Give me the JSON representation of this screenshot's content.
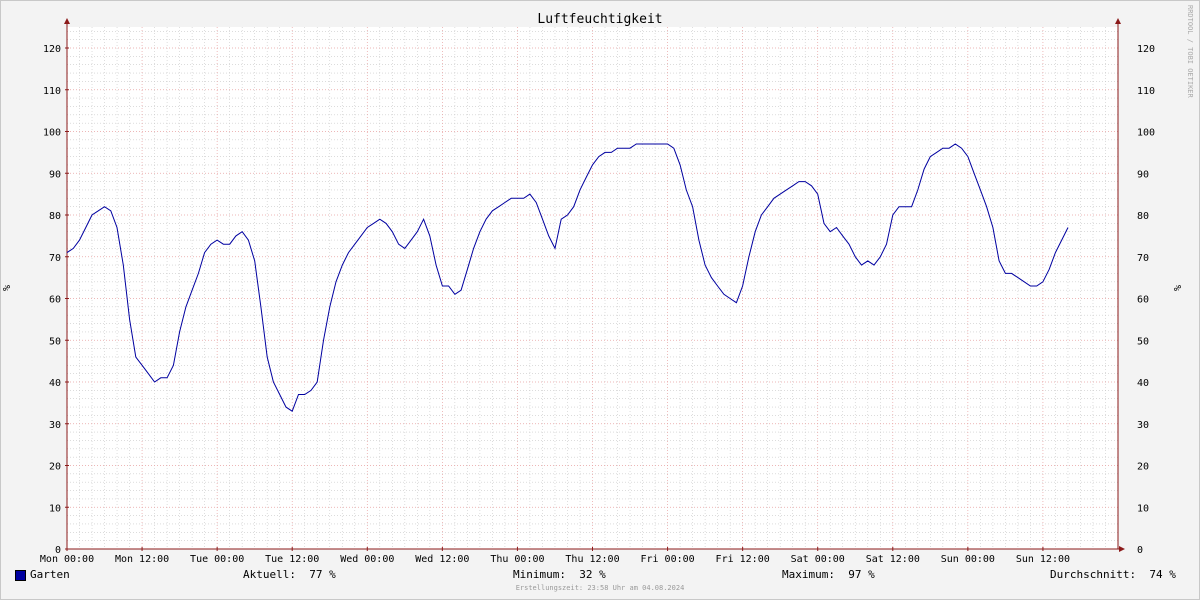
{
  "chart_data": {
    "type": "line",
    "title": "Luftfeuchtigkeit",
    "ylabel": "%",
    "ylim": [
      0,
      125
    ],
    "y_ticks": [
      0,
      10,
      20,
      30,
      40,
      50,
      60,
      70,
      80,
      90,
      100,
      110,
      120
    ],
    "x_range_hours": [
      0,
      168
    ],
    "x_ticks": [
      {
        "h": 0,
        "label": "Mon 00:00"
      },
      {
        "h": 12,
        "label": "Mon 12:00"
      },
      {
        "h": 24,
        "label": "Tue 00:00"
      },
      {
        "h": 36,
        "label": "Tue 12:00"
      },
      {
        "h": 48,
        "label": "Wed 00:00"
      },
      {
        "h": 60,
        "label": "Wed 12:00"
      },
      {
        "h": 72,
        "label": "Thu 00:00"
      },
      {
        "h": 84,
        "label": "Thu 12:00"
      },
      {
        "h": 96,
        "label": "Fri 00:00"
      },
      {
        "h": 108,
        "label": "Fri 12:00"
      },
      {
        "h": 120,
        "label": "Sat 00:00"
      },
      {
        "h": 132,
        "label": "Sat 12:00"
      },
      {
        "h": 144,
        "label": "Sun 00:00"
      },
      {
        "h": 156,
        "label": "Sun 12:00"
      }
    ],
    "grid": true,
    "colors": {
      "series": "#0000a0",
      "grid_major": "#e8a0a0",
      "grid_minor": "#c8c8c8",
      "axis": "#8b1a1a",
      "background": "#ffffff"
    },
    "series": [
      {
        "name": "Garten",
        "points": [
          [
            0,
            71
          ],
          [
            1,
            72
          ],
          [
            2,
            74
          ],
          [
            3,
            77
          ],
          [
            4,
            80
          ],
          [
            5,
            81
          ],
          [
            6,
            82
          ],
          [
            7,
            81
          ],
          [
            8,
            77
          ],
          [
            9,
            68
          ],
          [
            10,
            55
          ],
          [
            11,
            46
          ],
          [
            12,
            44
          ],
          [
            13,
            42
          ],
          [
            14,
            40
          ],
          [
            15,
            41
          ],
          [
            16,
            41
          ],
          [
            17,
            44
          ],
          [
            18,
            52
          ],
          [
            19,
            58
          ],
          [
            20,
            62
          ],
          [
            21,
            66
          ],
          [
            22,
            71
          ],
          [
            23,
            73
          ],
          [
            24,
            74
          ],
          [
            25,
            73
          ],
          [
            26,
            73
          ],
          [
            27,
            75
          ],
          [
            28,
            76
          ],
          [
            29,
            74
          ],
          [
            30,
            69
          ],
          [
            31,
            58
          ],
          [
            32,
            46
          ],
          [
            33,
            40
          ],
          [
            34,
            37
          ],
          [
            35,
            34
          ],
          [
            36,
            33
          ],
          [
            37,
            37
          ],
          [
            38,
            37
          ],
          [
            39,
            38
          ],
          [
            40,
            40
          ],
          [
            41,
            50
          ],
          [
            42,
            58
          ],
          [
            43,
            64
          ],
          [
            44,
            68
          ],
          [
            45,
            71
          ],
          [
            46,
            73
          ],
          [
            47,
            75
          ],
          [
            48,
            77
          ],
          [
            49,
            78
          ],
          [
            50,
            79
          ],
          [
            51,
            78
          ],
          [
            52,
            76
          ],
          [
            53,
            73
          ],
          [
            54,
            72
          ],
          [
            55,
            74
          ],
          [
            56,
            76
          ],
          [
            57,
            79
          ],
          [
            58,
            75
          ],
          [
            59,
            68
          ],
          [
            60,
            63
          ],
          [
            61,
            63
          ],
          [
            62,
            61
          ],
          [
            63,
            62
          ],
          [
            64,
            67
          ],
          [
            65,
            72
          ],
          [
            66,
            76
          ],
          [
            67,
            79
          ],
          [
            68,
            81
          ],
          [
            69,
            82
          ],
          [
            70,
            83
          ],
          [
            71,
            84
          ],
          [
            72,
            84
          ],
          [
            73,
            84
          ],
          [
            74,
            85
          ],
          [
            75,
            83
          ],
          [
            76,
            79
          ],
          [
            77,
            75
          ],
          [
            78,
            72
          ],
          [
            79,
            79
          ],
          [
            80,
            80
          ],
          [
            81,
            82
          ],
          [
            82,
            86
          ],
          [
            83,
            89
          ],
          [
            84,
            92
          ],
          [
            85,
            94
          ],
          [
            86,
            95
          ],
          [
            87,
            95
          ],
          [
            88,
            96
          ],
          [
            89,
            96
          ],
          [
            90,
            96
          ],
          [
            91,
            97
          ],
          [
            92,
            97
          ],
          [
            93,
            97
          ],
          [
            94,
            97
          ],
          [
            95,
            97
          ],
          [
            96,
            97
          ],
          [
            97,
            96
          ],
          [
            98,
            92
          ],
          [
            99,
            86
          ],
          [
            100,
            82
          ],
          [
            101,
            74
          ],
          [
            102,
            68
          ],
          [
            103,
            65
          ],
          [
            104,
            63
          ],
          [
            105,
            61
          ],
          [
            106,
            60
          ],
          [
            107,
            59
          ],
          [
            108,
            63
          ],
          [
            109,
            70
          ],
          [
            110,
            76
          ],
          [
            111,
            80
          ],
          [
            112,
            82
          ],
          [
            113,
            84
          ],
          [
            114,
            85
          ],
          [
            115,
            86
          ],
          [
            116,
            87
          ],
          [
            117,
            88
          ],
          [
            118,
            88
          ],
          [
            119,
            87
          ],
          [
            120,
            85
          ],
          [
            121,
            78
          ],
          [
            122,
            76
          ],
          [
            123,
            77
          ],
          [
            124,
            75
          ],
          [
            125,
            73
          ],
          [
            126,
            70
          ],
          [
            127,
            68
          ],
          [
            128,
            69
          ],
          [
            129,
            68
          ],
          [
            130,
            70
          ],
          [
            131,
            73
          ],
          [
            132,
            80
          ],
          [
            133,
            82
          ],
          [
            134,
            82
          ],
          [
            135,
            82
          ],
          [
            136,
            86
          ],
          [
            137,
            91
          ],
          [
            138,
            94
          ],
          [
            139,
            95
          ],
          [
            140,
            96
          ],
          [
            141,
            96
          ],
          [
            142,
            97
          ],
          [
            143,
            96
          ],
          [
            144,
            94
          ],
          [
            145,
            90
          ],
          [
            146,
            86
          ],
          [
            147,
            82
          ],
          [
            148,
            77
          ],
          [
            149,
            69
          ],
          [
            150,
            66
          ],
          [
            151,
            66
          ],
          [
            152,
            65
          ],
          [
            153,
            64
          ],
          [
            154,
            63
          ],
          [
            155,
            63
          ],
          [
            156,
            64
          ],
          [
            157,
            67
          ],
          [
            158,
            71
          ],
          [
            159,
            74
          ],
          [
            160,
            77
          ]
        ]
      }
    ]
  },
  "legend": {
    "series_name": "Garten",
    "current_label": "Aktuell:",
    "current_value": "77 %",
    "minimum_label": "Minimum:",
    "minimum_value": "32 %",
    "maximum_label": "Maximum:",
    "maximum_value": "97 %",
    "average_label": "Durchschnitt:",
    "average_value": "74 %"
  },
  "footer": "Erstellungszeit: 23:58 Uhr am 04.08.2024",
  "watermark": "RRDTOOL / TOBI OETIKER"
}
